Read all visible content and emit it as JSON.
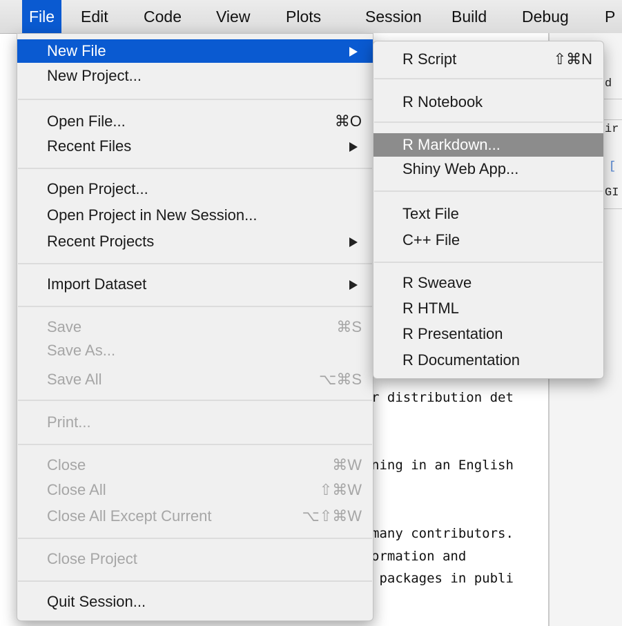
{
  "menubar": [
    "File",
    "Edit",
    "Code",
    "View",
    "Plots",
    "Session",
    "Build",
    "Debug",
    "P"
  ],
  "file_menu": {
    "items": [
      {
        "label": "New File",
        "shortcut": "",
        "has_arrow": true,
        "state": "highlighted"
      },
      {
        "label": "New Project...",
        "shortcut": "",
        "has_arrow": false,
        "state": "enabled"
      },
      {
        "label": "Open File...",
        "shortcut": "⌘O",
        "has_arrow": false,
        "state": "enabled"
      },
      {
        "label": "Recent Files",
        "shortcut": "",
        "has_arrow": true,
        "state": "enabled"
      },
      {
        "label": "Open Project...",
        "shortcut": "",
        "has_arrow": false,
        "state": "enabled"
      },
      {
        "label": "Open Project in New Session...",
        "shortcut": "",
        "has_arrow": false,
        "state": "enabled"
      },
      {
        "label": "Recent Projects",
        "shortcut": "",
        "has_arrow": true,
        "state": "enabled"
      },
      {
        "label": "Import Dataset",
        "shortcut": "",
        "has_arrow": true,
        "state": "enabled"
      },
      {
        "label": "Save",
        "shortcut": "⌘S",
        "has_arrow": false,
        "state": "disabled"
      },
      {
        "label": "Save As...",
        "shortcut": "",
        "has_arrow": false,
        "state": "disabled"
      },
      {
        "label": "Save All",
        "shortcut": "⌥⌘S",
        "has_arrow": false,
        "state": "disabled"
      },
      {
        "label": "Print...",
        "shortcut": "",
        "has_arrow": false,
        "state": "disabled"
      },
      {
        "label": "Close",
        "shortcut": "⌘W",
        "has_arrow": false,
        "state": "disabled"
      },
      {
        "label": "Close All",
        "shortcut": "⇧⌘W",
        "has_arrow": false,
        "state": "disabled"
      },
      {
        "label": "Close All Except Current",
        "shortcut": "⌥⇧⌘W",
        "has_arrow": false,
        "state": "disabled"
      },
      {
        "label": "Close Project",
        "shortcut": "",
        "has_arrow": false,
        "state": "disabled"
      },
      {
        "label": "Quit Session...",
        "shortcut": "",
        "has_arrow": false,
        "state": "enabled"
      }
    ]
  },
  "new_file_submenu": {
    "items": [
      {
        "label": "R Script",
        "shortcut": "⇧⌘N",
        "state": "enabled"
      },
      {
        "label": "R Notebook",
        "shortcut": "",
        "state": "enabled"
      },
      {
        "label": "R Markdown...",
        "shortcut": "",
        "state": "highlighted"
      },
      {
        "label": "Shiny Web App...",
        "shortcut": "",
        "state": "enabled"
      },
      {
        "label": "Text File",
        "shortcut": "",
        "state": "enabled"
      },
      {
        "label": "C++ File",
        "shortcut": "",
        "state": "enabled"
      },
      {
        "label": "R Sweave",
        "shortcut": "",
        "state": "enabled"
      },
      {
        "label": "R HTML",
        "shortcut": "",
        "state": "enabled"
      },
      {
        "label": "R Presentation",
        "shortcut": "",
        "state": "enabled"
      },
      {
        "label": "R Documentation",
        "shortcut": "",
        "state": "enabled"
      }
    ]
  },
  "background_code": [
    "r distribution det",
    "ning in an English",
    "many contributors.",
    "ormation and",
    " packages in publi"
  ],
  "right_pane_fragments": [
    "d",
    "ir",
    "[",
    "GI"
  ],
  "colors": {
    "highlight": "#0a5ad1",
    "submenu_highlight": "#8c8c8c",
    "disabled_text": "#a6a6a6"
  }
}
